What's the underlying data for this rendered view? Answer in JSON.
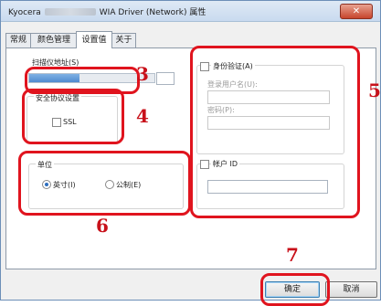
{
  "window": {
    "title_prefix": "Kyocera",
    "title_suffix": "WIA Driver (Network) 属性",
    "close_symbol": "✕"
  },
  "tabs": [
    {
      "label": "常规",
      "active": false
    },
    {
      "label": "颜色管理",
      "active": false
    },
    {
      "label": "设置值",
      "active": true
    },
    {
      "label": "关于",
      "active": false
    }
  ],
  "scanner_address": {
    "label": "扫描仪地址(S)",
    "progress_fraction": 0.4
  },
  "security": {
    "group_label": "安全协议设置",
    "ssl_label": "SSL",
    "ssl_checked": false
  },
  "unit": {
    "group_label": "单位",
    "inch_label": "英寸(I)",
    "metric_label": "公制(E)",
    "selected": "inch"
  },
  "auth": {
    "label": "身份验证(A)",
    "login_label": "登录用户名(U):",
    "password_label": "密码(P):",
    "account_label": "帐户 ID",
    "checked": false,
    "account_checked": false
  },
  "buttons": {
    "ok": "确定",
    "cancel": "取消"
  },
  "annotations": {
    "n3": "3",
    "n4": "4",
    "n5": "5",
    "n6": "6",
    "n7": "7"
  },
  "colors": {
    "annotation_red": "#e0141e",
    "progress_blue": "#4f8bd0"
  }
}
